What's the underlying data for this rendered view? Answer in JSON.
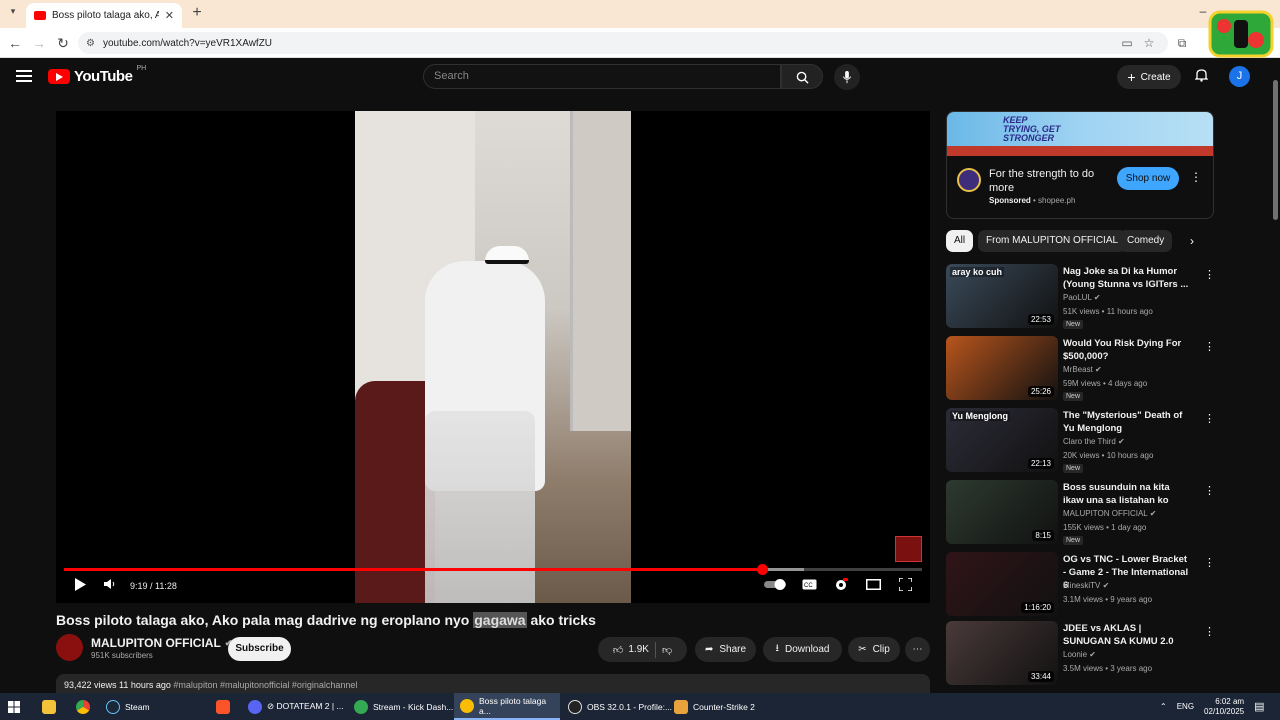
{
  "browser": {
    "tab_title": "Boss piloto talaga ako, Ako pala",
    "url": "youtube.com/watch?v=yeVR1XAwfZU"
  },
  "header": {
    "logo": "YouTube",
    "region": "PH",
    "search_placeholder": "Search",
    "create_label": "Create",
    "avatar_letter": "J"
  },
  "player": {
    "time": "9:19 / 11:28",
    "progress": 0.813
  },
  "video": {
    "title_before": "Boss piloto talaga ako, Ako pala mag dadrive ng eroplano nyo ",
    "title_highlight": "gagawa",
    "title_after": " ako tricks",
    "channel": "MALUPITON OFFICIAL",
    "subscribers": "951K subscribers",
    "subscribe_label": "Subscribe",
    "likes": "1.9K",
    "share_label": "Share",
    "download_label": "Download",
    "clip_label": "Clip",
    "views_time": "93,422 views  11 hours ago",
    "tags": "#malupiton #malupitonofficial #originalchannel"
  },
  "ad": {
    "banner_text": "KEEP TRYING, GET STRONGER",
    "text": "For the strength to do more",
    "sponsored": "Sponsored",
    "domain": "shopee.ph",
    "cta": "Shop now"
  },
  "chips": [
    "All",
    "From MALUPITON OFFICIAL",
    "Comedy"
  ],
  "recommendations": [
    {
      "title": "Nag Joke sa Di ka Humor (Young Stunna vs IGITers ...",
      "channel": "PaoLUL",
      "meta": "51K views • 11 hours ago",
      "duration": "22:53",
      "badge": "New",
      "thumb_label": "aray ko cuh",
      "color": "#3a4a5a"
    },
    {
      "title": "Would You Risk Dying For $500,000?",
      "channel": "MrBeast",
      "meta": "59M views • 4 days ago",
      "duration": "25:26",
      "badge": "New",
      "thumb_label": "",
      "color": "#b8551c"
    },
    {
      "title": "The \"Mysterious\" Death of Yu Menglong",
      "channel": "Claro the Third",
      "meta": "20K views • 10 hours ago",
      "duration": "22:13",
      "badge": "New",
      "thumb_label": "Yu Menglong",
      "color": "#2c2c38"
    },
    {
      "title": "Boss susunduin na kita ikaw una sa listahan ko",
      "channel": "MALUPITON OFFICIAL",
      "meta": "155K views • 1 day ago",
      "duration": "8:15",
      "badge": "New",
      "thumb_label": "",
      "color": "#2d3a30"
    },
    {
      "title": "OG vs TNC - Lower Bracket - Game 2 - The International 6",
      "channel": "MineskiTV",
      "meta": "3.1M views • 9 years ago",
      "duration": "1:16:20",
      "badge": "",
      "thumb_label": "",
      "color": "#301418"
    },
    {
      "title": "JDEE vs AKLAS | SUNUGAN SA KUMU 2.0",
      "channel": "Loonie",
      "meta": "3.5M views • 3 years ago",
      "duration": "33:44",
      "badge": "",
      "thumb_label": "",
      "color": "#4a3a3a"
    }
  ],
  "taskbar": {
    "items": [
      "Steam",
      "⊘ DOTATEAM 2 | ...",
      "Stream - Kick Dash...",
      "Boss piloto talaga a...",
      "OBS 32.0.1 - Profile:...",
      "Counter-Strike 2"
    ],
    "lang": "ENG",
    "time": "6:02 am",
    "date": "02/10/2025"
  }
}
